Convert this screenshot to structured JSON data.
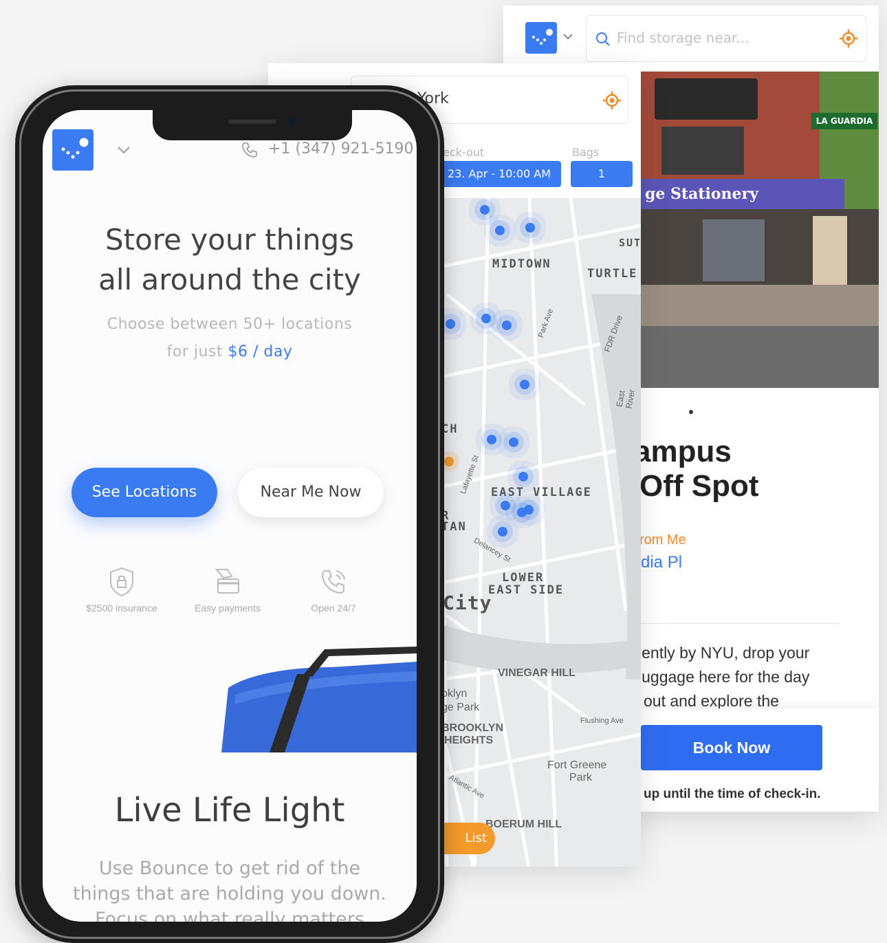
{
  "colors": {
    "brand_blue": "#3b7bf2",
    "accent_orange": "#f08a2c",
    "text_dark": "#444444",
    "text_muted": "#b8b8bc"
  },
  "detail_screen": {
    "search_placeholder": "Find storage near...",
    "title_line1": "ampus",
    "title_line2": "Off Spot",
    "distance_text": "rom Me",
    "address_text": "dia Pl",
    "description": [
      "iently by NYU, drop your",
      "luggage here for the day",
      "out and explore the"
    ],
    "book_button": "Book Now",
    "cancel_note": "up until the time of check-in.",
    "photo_sign_main": "ge Stationery",
    "photo_sign_street": "LA GUARDIA",
    "icons": [
      "search-icon",
      "locate-icon",
      "chevron-down-icon"
    ]
  },
  "map_screen": {
    "search_value": "York",
    "checkout_label": "eck-out",
    "bags_label": "Bags",
    "checkout_value": "23. Apr - 10:00 AM",
    "bags_value": "1",
    "list_button": "List",
    "map_labels": {
      "midtown": "MIDTOWN",
      "turtle": "TURTLE",
      "east_village": "EAST VILLAGE",
      "lower_east_side_1": "LOWER",
      "lower_east_side_2": "EAST SIDE",
      "city": "City",
      "ch": "CH",
      "tan": "TAN",
      "r": "R",
      "vinegar_hill": "VINEGAR HILL",
      "brooklyn_heights_1": "BROOKLYN",
      "brooklyn_heights_2": "HEIGHTS",
      "bk_park_1": "oklyn",
      "bk_park_2": "ge Park",
      "fort_greene_1": "Fort Greene",
      "fort_greene_2": "Park",
      "boerum_hill": "BOERUM HILL",
      "sut": "SUT",
      "fdr": "FDR Drive",
      "east_river": "East River",
      "flushing": "Flushing Ave",
      "delancey": "Delancey St",
      "lafayette": "Lafayette St",
      "atlantic": "Atlantic Ave",
      "park_ave": "Park Ave"
    }
  },
  "home_screen": {
    "phone_number": "+1 (347) 921-5190",
    "hero_title_line1": "Store your things",
    "hero_title_line2": "all around the city",
    "hero_sub_line1": "Choose between 50+ locations",
    "hero_sub_prefix": "for just ",
    "hero_sub_price": "$6 / day",
    "cta_primary": "See Locations",
    "cta_secondary": "Near Me Now",
    "features": [
      {
        "icon": "shield-lock-icon",
        "label": "$2500 insurance"
      },
      {
        "icon": "card-payment-icon",
        "label": "Easy payments"
      },
      {
        "icon": "phone-ring-icon",
        "label": "Open 24/7"
      }
    ],
    "section_title": "Live Life Light",
    "section_body": [
      "Use Bounce to get rid of the",
      "things that are holding you down.",
      "Focus on what really matters"
    ]
  }
}
